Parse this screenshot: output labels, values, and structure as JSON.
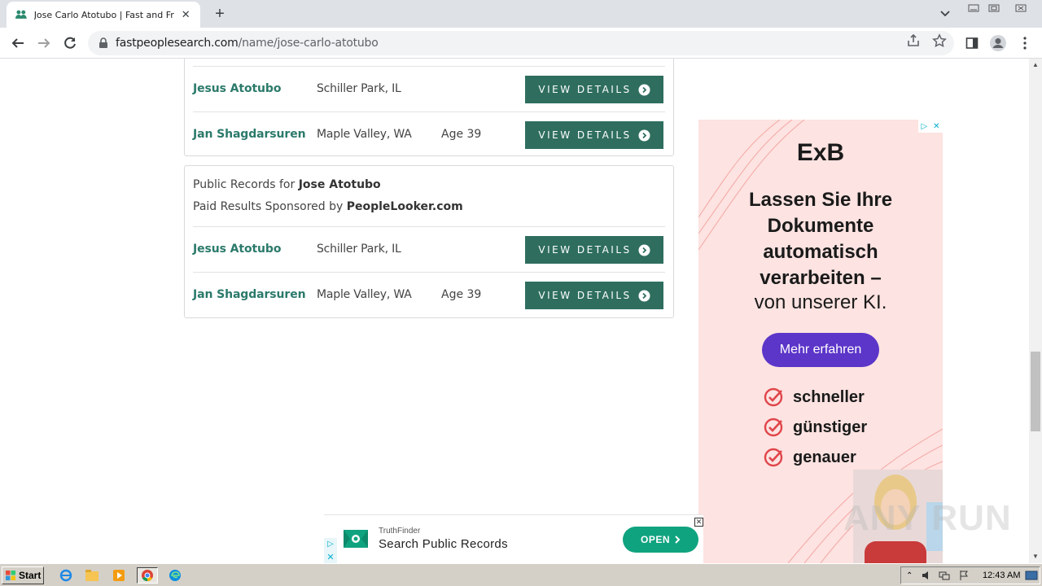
{
  "browser": {
    "tab_title": "Jose Carlo Atotubo | Fast and Free People Search",
    "url_host": "fastpeoplesearch.com",
    "url_path": "/name/jose-carlo-atotubo"
  },
  "card1": {
    "rows": [
      {
        "name": "Jesus Atotubo",
        "location": "Schiller Park, IL",
        "age": "",
        "button": "VIEW DETAILS"
      },
      {
        "name": "Jan Shagdarsuren",
        "location": "Maple Valley, WA",
        "age": "Age 39",
        "button": "VIEW DETAILS"
      }
    ]
  },
  "card2": {
    "heading_prefix": "Public Records for ",
    "heading_name": "Jose Atotubo",
    "sponsor_prefix": "Paid Results Sponsored by ",
    "sponsor_name": "PeopleLooker.com",
    "rows": [
      {
        "name": "Jesus Atotubo",
        "location": "Schiller Park, IL",
        "age": "",
        "button": "VIEW DETAILS"
      },
      {
        "name": "Jan Shagdarsuren",
        "location": "Maple Valley, WA",
        "age": "Age 39",
        "button": "VIEW DETAILS"
      }
    ]
  },
  "side_ad": {
    "brand": "ExB",
    "headline": "Lassen Sie Ihre Dokumente automatisch verarbeiten –",
    "sub": "von unserer KI.",
    "cta": "Mehr erfahren",
    "bullets": [
      "schneller",
      "günstiger",
      "genauer"
    ],
    "accent": "#5c35c9",
    "background": "#fde3e1"
  },
  "banner_ad": {
    "advertiser": "TruthFinder",
    "headline": "Search Public Records",
    "cta": "OPEN",
    "accent": "#10a37f"
  },
  "watermark": "ANY RUN",
  "taskbar": {
    "start_label": "Start",
    "clock": "12:43 AM"
  },
  "colors": {
    "name_link": "#2b7a6b",
    "button": "#2f6e5f"
  }
}
